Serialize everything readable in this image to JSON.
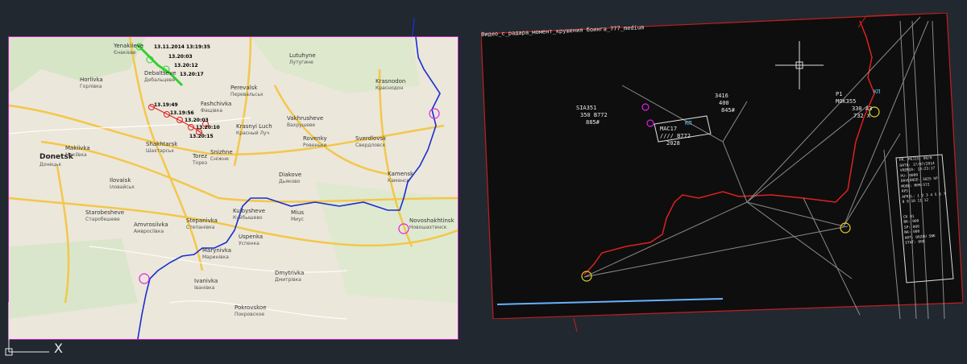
{
  "map": {
    "cities": [
      {
        "name": "Shakhtarsk",
        "cyr": "Шахтарськ"
      },
      {
        "name": "Snizhne",
        "cyr": "Сніжне"
      },
      {
        "name": "Torez",
        "cyr": "Торез"
      },
      {
        "name": "Donetsk",
        "cyr": "Донецьк"
      },
      {
        "name": "Krasnyi Luch",
        "cyr": "Красный Луч"
      },
      {
        "name": "Rovenky",
        "cyr": "Ровеньки"
      },
      {
        "name": "Sverdlovsk",
        "cyr": "Свердловск"
      },
      {
        "name": "Krasnodon",
        "cyr": "Краснодон"
      },
      {
        "name": "Debaltseve",
        "cyr": "Дебальцеве"
      },
      {
        "name": "Yenakiieve",
        "cyr": "Єнакієве"
      },
      {
        "name": "Horlivka",
        "cyr": "Горлівка"
      },
      {
        "name": "Makiivka",
        "cyr": "Макіївка"
      },
      {
        "name": "Amvrosiivka",
        "cyr": "Амвросіївка"
      },
      {
        "name": "Ilovaisk",
        "cyr": "Іловайськ"
      },
      {
        "name": "Kuibysheve",
        "cyr": "Куйбышево"
      },
      {
        "name": "Novoshakhtinsk",
        "cyr": "Новошахтинск"
      },
      {
        "name": "Pokrovskoe",
        "cyr": "Покровское"
      },
      {
        "name": "Kamensk",
        "cyr": "Каменск"
      },
      {
        "name": "Mius",
        "cyr": "Миус"
      },
      {
        "name": "Fashchivka",
        "cyr": "Фащівка"
      },
      {
        "name": "Lutuhyne",
        "cyr": "Лутугине"
      },
      {
        "name": "Diakove",
        "cyr": "Дьяково"
      },
      {
        "name": "Stepanivka",
        "cyr": "Степанівка"
      },
      {
        "name": "Marynivka",
        "cyr": "Маринівка"
      },
      {
        "name": "Perevalsk",
        "cyr": "Перевальськ"
      },
      {
        "name": "Vakhrusheve",
        "cyr": "Вахрушеве"
      },
      {
        "name": "Ivanivka",
        "cyr": "Іванівка"
      },
      {
        "name": "Dmytrivka",
        "cyr": "Дмитрівка"
      },
      {
        "name": "Starobesheve",
        "cyr": "Старобешеве"
      },
      {
        "name": "Uspenka",
        "cyr": "Успенка"
      }
    ],
    "track_green_labels": [
      "13.11.2014 13:19:35",
      "13.20:03",
      "13.20:12",
      "13.20:17"
    ],
    "track_red_labels": [
      "13.19:49",
      "13.19:56",
      "13.20:03",
      "13.20:10",
      "13.20:15"
    ],
    "colors": {
      "border_blue": "#1a2ed0",
      "track_green": "#30d030",
      "track_red": "#e02020",
      "highlight": "#e020e0"
    }
  },
  "radar": {
    "title": "Видео_с_радара_момент_крушения боинга_777_medium",
    "blocks": [
      {
        "id": "left-block",
        "lines": [
          "SIA351",
          "350 B772",
          "885#"
        ]
      },
      {
        "id": "center-block",
        "lines": [
          "MAC17",
          "//// B772",
          "2028"
        ]
      },
      {
        "id": "upper-block",
        "lines": [
          "3416",
          "400",
          "845#"
        ]
      },
      {
        "id": "right-block",
        "lines": [
          "P1",
          "MOK355",
          "330 A3",
          "732 X"
        ]
      }
    ],
    "kp_labels": [
      "КП",
      "КП"
    ],
    "side_panel": [
      "PR. PEJIS: 00/0",
      "DATA: 17/07/2014",
      "VREMIA: 13:23:17",
      "PU: 0000",
      "DAVLENIE: 1025 hP",
      "MODE: MPR-572",
      "RPS:",
      "APRIL: 1 2 3 4 5 6 7",
      "8 9 10 11 12",
      "CK 01",
      "BK: 000",
      "SP: 000",
      "NA: 000",
      "ART: 00ZAU SNK",
      "STAT: 000"
    ]
  },
  "ucs": {
    "x_label": "X"
  }
}
